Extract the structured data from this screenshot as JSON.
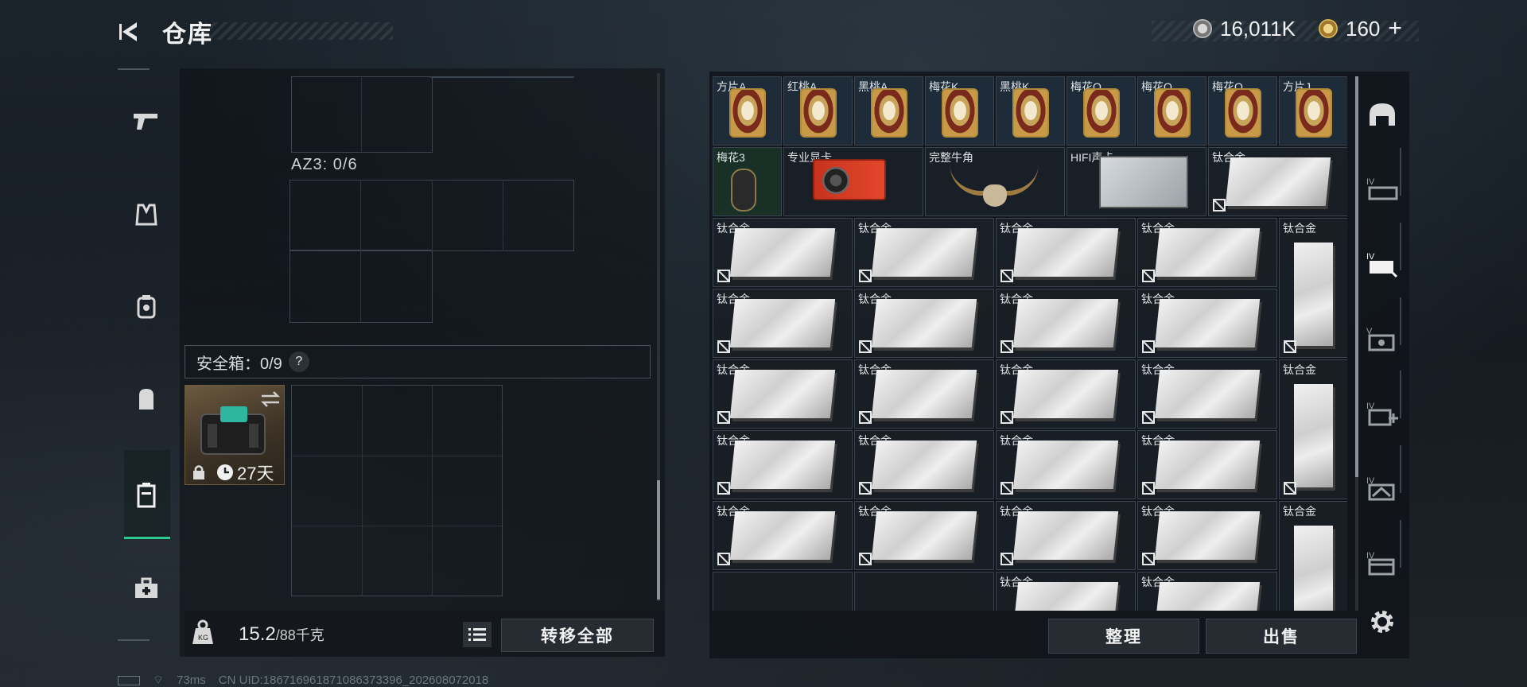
{
  "header": {
    "title": "仓库",
    "currency_primary": "16,011K",
    "currency_secondary": "160",
    "currency_secondary_add": "+"
  },
  "left_panel": {
    "az3_label": "AZ3: 0/6",
    "safebox_label": "安全箱：0/9",
    "safebox_help": "?",
    "safebox_days": "27天",
    "weight_current": "15.2",
    "weight_max": "/88千克",
    "weight_icon_label": "KG",
    "transfer_all": "转移全部"
  },
  "right_panel": {
    "cards": [
      "方片A",
      "红桃A",
      "黑桃A",
      "梅花K",
      "黑桃K",
      "梅花Q",
      "梅花Q",
      "梅花Q",
      "方片J"
    ],
    "row2": [
      "梅花3",
      "专业显卡",
      "完整牛角",
      "HIFI声卡",
      "钛合金"
    ],
    "material": "钛合金",
    "organize": "整理",
    "sell": "出售"
  },
  "footer": {
    "ping": "73ms",
    "uid": "CN UID:1867169618710863733​96_202608072018"
  },
  "colors": {
    "accent_green": "#29c98f",
    "panel_bg": "#10141a",
    "border": "#3a4450"
  },
  "icons": {
    "left_rail": [
      "pistol-icon",
      "vest-icon",
      "armor-icon",
      "backpack-icon",
      "safebox-icon",
      "medkit-icon"
    ],
    "right_rail": [
      "helmet-icon",
      "weapon-case-icon",
      "weapon-case-selected-icon",
      "equipment-icon",
      "medical-case-icon",
      "tools-icon",
      "folder-icon",
      "settings-icon"
    ]
  }
}
